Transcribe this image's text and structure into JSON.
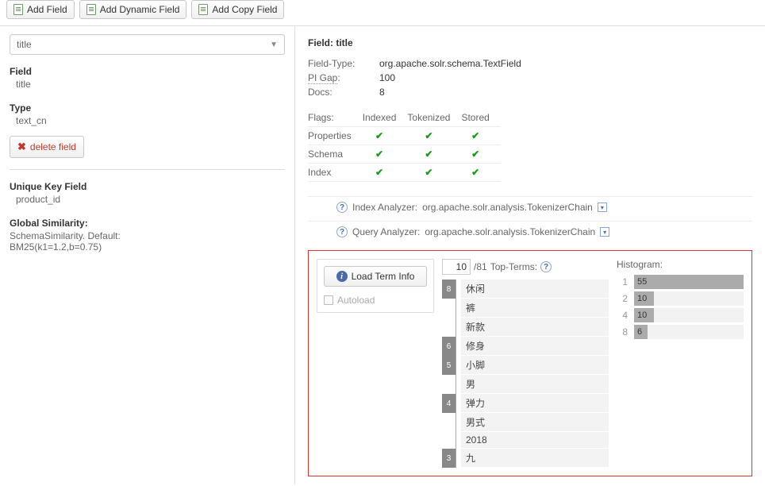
{
  "toolbar": {
    "add_field": "Add Field",
    "add_dynamic_field": "Add Dynamic Field",
    "add_copy_field": "Add Copy Field"
  },
  "sidebar": {
    "selected_field": "title",
    "field_label": "Field",
    "field_value": "title",
    "type_label": "Type",
    "type_value": "text_cn",
    "delete_label": "delete field",
    "unique_key_label": "Unique Key Field",
    "unique_key_value": "product_id",
    "global_sim_label": "Global Similarity:",
    "global_sim_line1": "SchemaSimilarity. Default:",
    "global_sim_line2": "BM25(k1=1.2,b=0.75)"
  },
  "detail": {
    "heading": "Field: title",
    "rows": {
      "field_type_k": "Field-Type:",
      "field_type_v": "org.apache.solr.schema.TextField",
      "pi_gap_k": "PI Gap",
      "pi_gap_colon": ":",
      "pi_gap_v": "100",
      "docs_k": "Docs:",
      "docs_v": "8"
    },
    "flags": {
      "label": "Flags:",
      "cols": [
        "Indexed",
        "Tokenized",
        "Stored"
      ],
      "rows": [
        "Properties",
        "Schema",
        "Index"
      ]
    },
    "index_analyzer_label": "Index Analyzer:",
    "index_analyzer_value": "org.apache.solr.analysis.TokenizerChain",
    "query_analyzer_label": "Query Analyzer:",
    "query_analyzer_value": "org.apache.solr.analysis.TokenizerChain"
  },
  "terms": {
    "load_btn": "Load Term Info",
    "autoload": "Autoload",
    "input_value": "10",
    "total": "/81",
    "top_terms_label": "Top-Terms:",
    "list": [
      {
        "count": "8",
        "term": "休闲"
      },
      {
        "count": "",
        "term": "裤"
      },
      {
        "count": "",
        "term": "新款"
      },
      {
        "count": "6",
        "term": "修身"
      },
      {
        "count": "5",
        "term": "小脚"
      },
      {
        "count": "",
        "term": "男"
      },
      {
        "count": "4",
        "term": "弹力"
      },
      {
        "count": "",
        "term": "男式"
      },
      {
        "count": "",
        "term": "2018"
      },
      {
        "count": "3",
        "term": "九"
      }
    ]
  },
  "histogram": {
    "label": "Histogram:",
    "max": 55,
    "rows": [
      {
        "k": "1",
        "v": 55
      },
      {
        "k": "2",
        "v": 10
      },
      {
        "k": "4",
        "v": 10
      },
      {
        "k": "8",
        "v": 6
      }
    ]
  }
}
